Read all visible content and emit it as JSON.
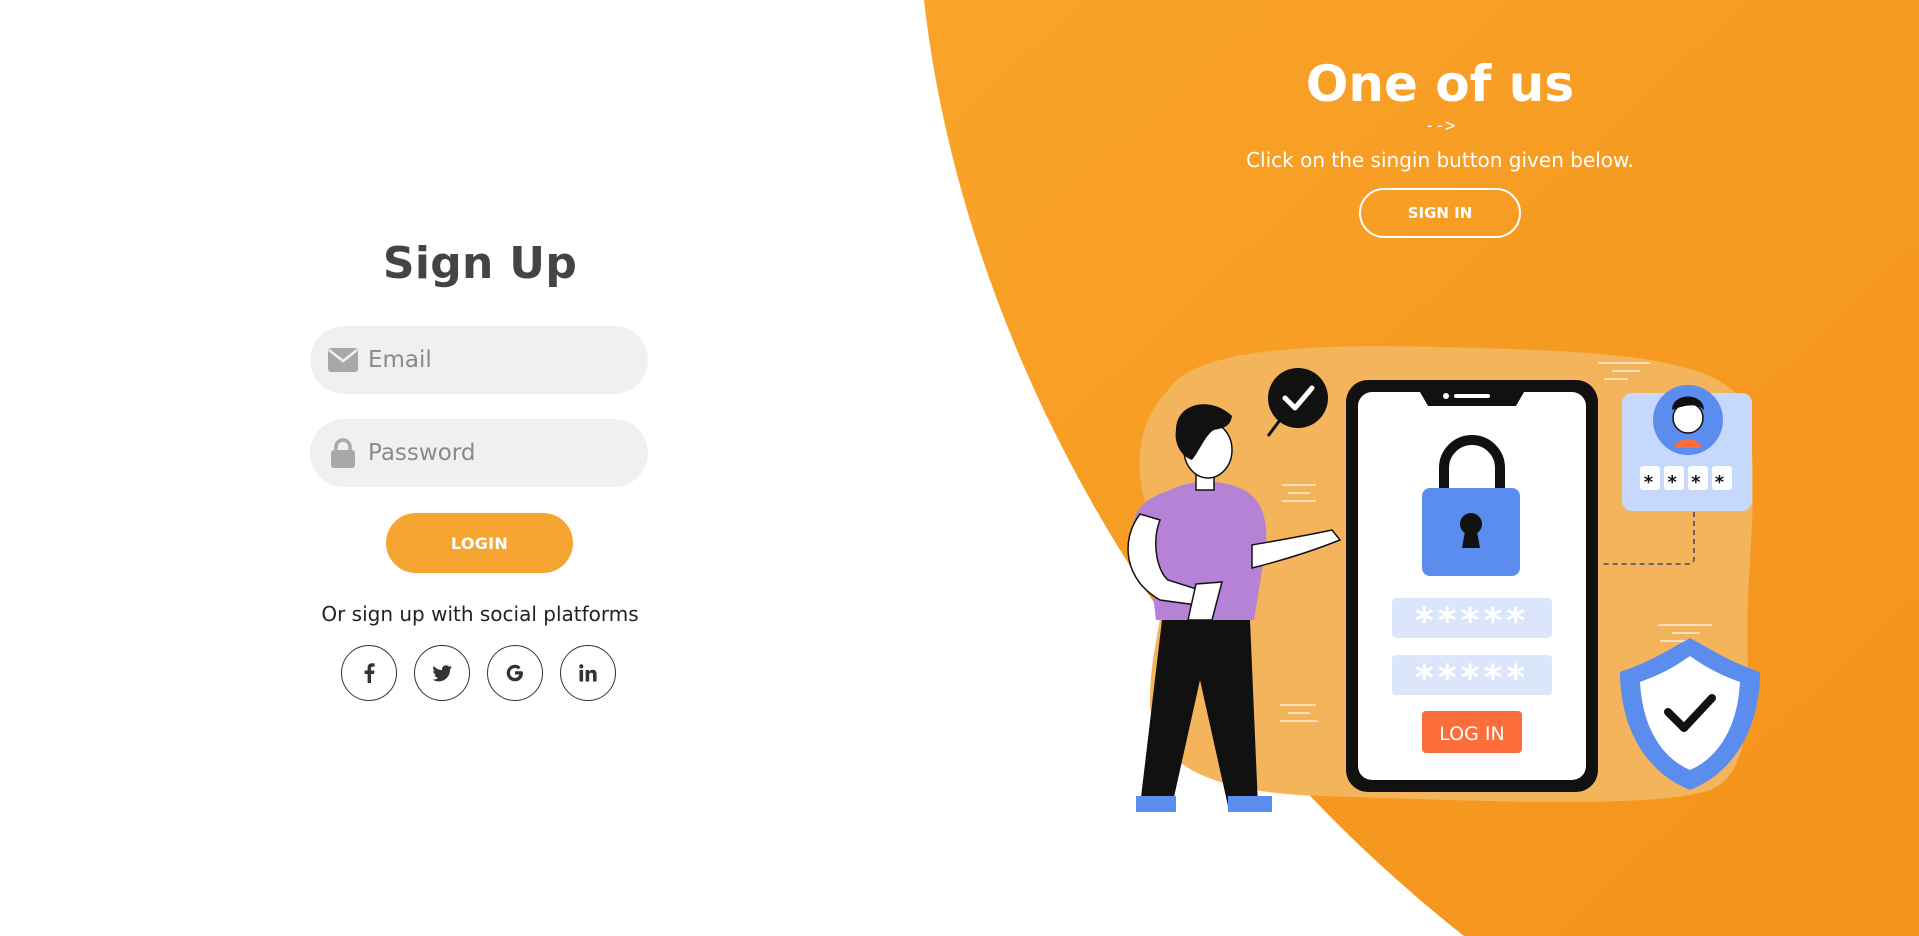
{
  "colors": {
    "accent": "#f7a531",
    "panel_orange": "#f69b1d",
    "title_text": "#444444"
  },
  "signup": {
    "title": "Sign Up",
    "email_placeholder": "Email",
    "password_placeholder": "Password",
    "login_label": "LOGIN",
    "social_text": "Or sign up with social platforms",
    "social_icons": [
      "facebook-icon",
      "twitter-icon",
      "google-icon",
      "linkedin-icon"
    ]
  },
  "panel": {
    "title": "One of us",
    "arrow": "-->",
    "description": "Click on the singin button given below.",
    "signin_label": "SIGN IN"
  },
  "illustration": {
    "password_mask": "*****",
    "login_label": "LOG IN",
    "pin_mask": "* * * *"
  }
}
